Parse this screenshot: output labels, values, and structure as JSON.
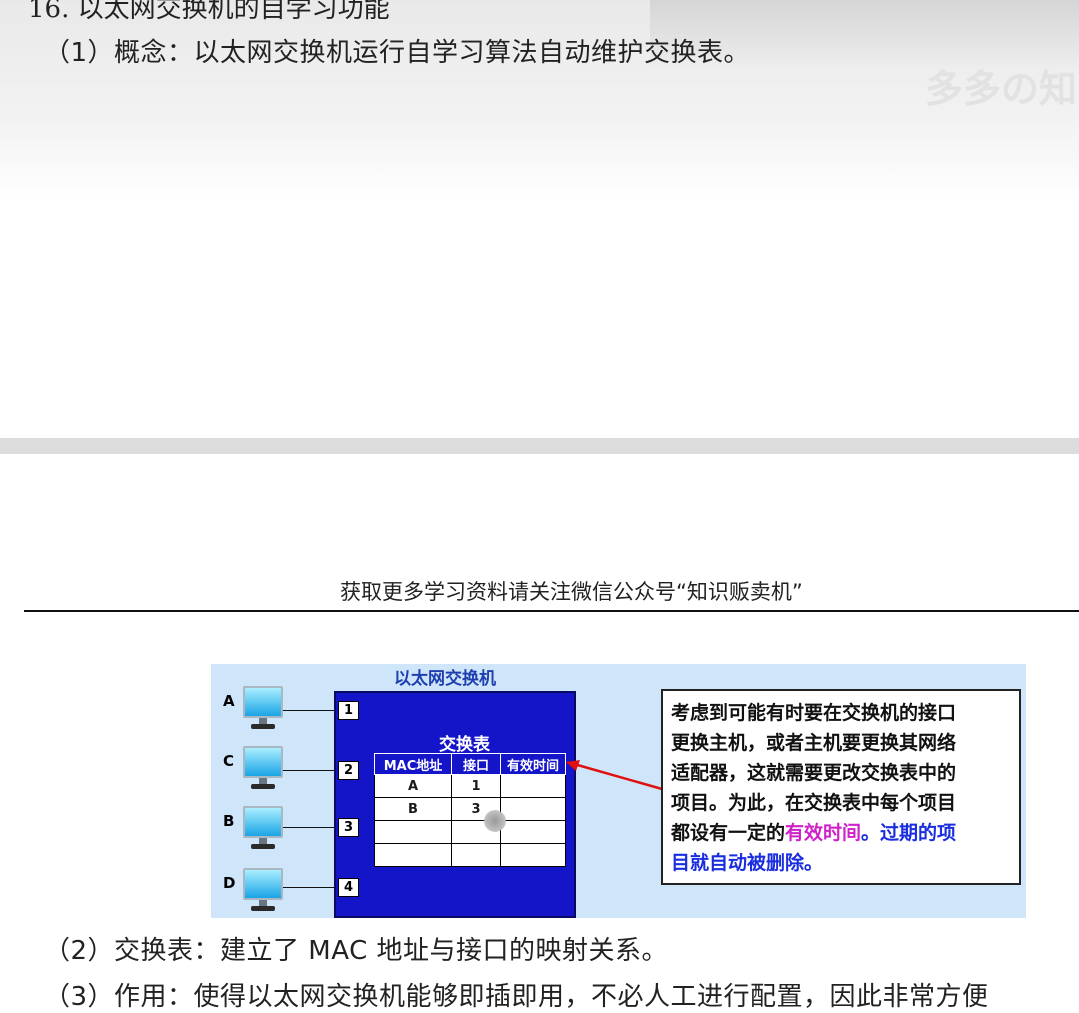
{
  "page_top": {
    "heading": "16. 以太网交换机的自学习功能",
    "concept_para": "（1）概念：以太网交换机运行自学习算法自动维护交换表。",
    "watermark": "多多の知"
  },
  "page_bottom": {
    "footer_note": "获取更多学习资料请关注微信公众号“知识贩卖机”",
    "para_2": "（2）交换表：建立了 MAC 地址与接口的映射关系。",
    "para_3": "（3）作用：使得以太网交换机能够即插即用，不必人工进行配置，因此非常方便"
  },
  "diagram": {
    "title": "以太网交换机",
    "hosts": [
      "A",
      "C",
      "B",
      "D"
    ],
    "ports": [
      "1",
      "2",
      "3",
      "4"
    ],
    "table_title": "交换表",
    "table_headers": [
      "MAC地址",
      "接口",
      "有效时间"
    ],
    "table_rows": [
      [
        "A",
        "1",
        ""
      ],
      [
        "B",
        "3",
        ""
      ],
      [
        "",
        "",
        ""
      ],
      [
        "",
        "",
        ""
      ]
    ],
    "note": {
      "line1": "考虑到可能有时要在交换机的接口",
      "line2": "更换主机，或者主机要更换其网络",
      "line3": "适配器，这就需要更改交换表中的",
      "line4": "项目。为此，在交换表中每个项目",
      "line5_prefix": "都设有一定的",
      "line5_highlight": "有效时间",
      "line5_suffix": "。过期的项",
      "line6": "目就自动被删除。"
    },
    "colors": {
      "switch_body": "#1414c8",
      "background": "#cfe6fa",
      "highlight_magenta": "#d020c8",
      "highlight_blue": "#1a2ee0",
      "arrow": "#e01010"
    }
  }
}
